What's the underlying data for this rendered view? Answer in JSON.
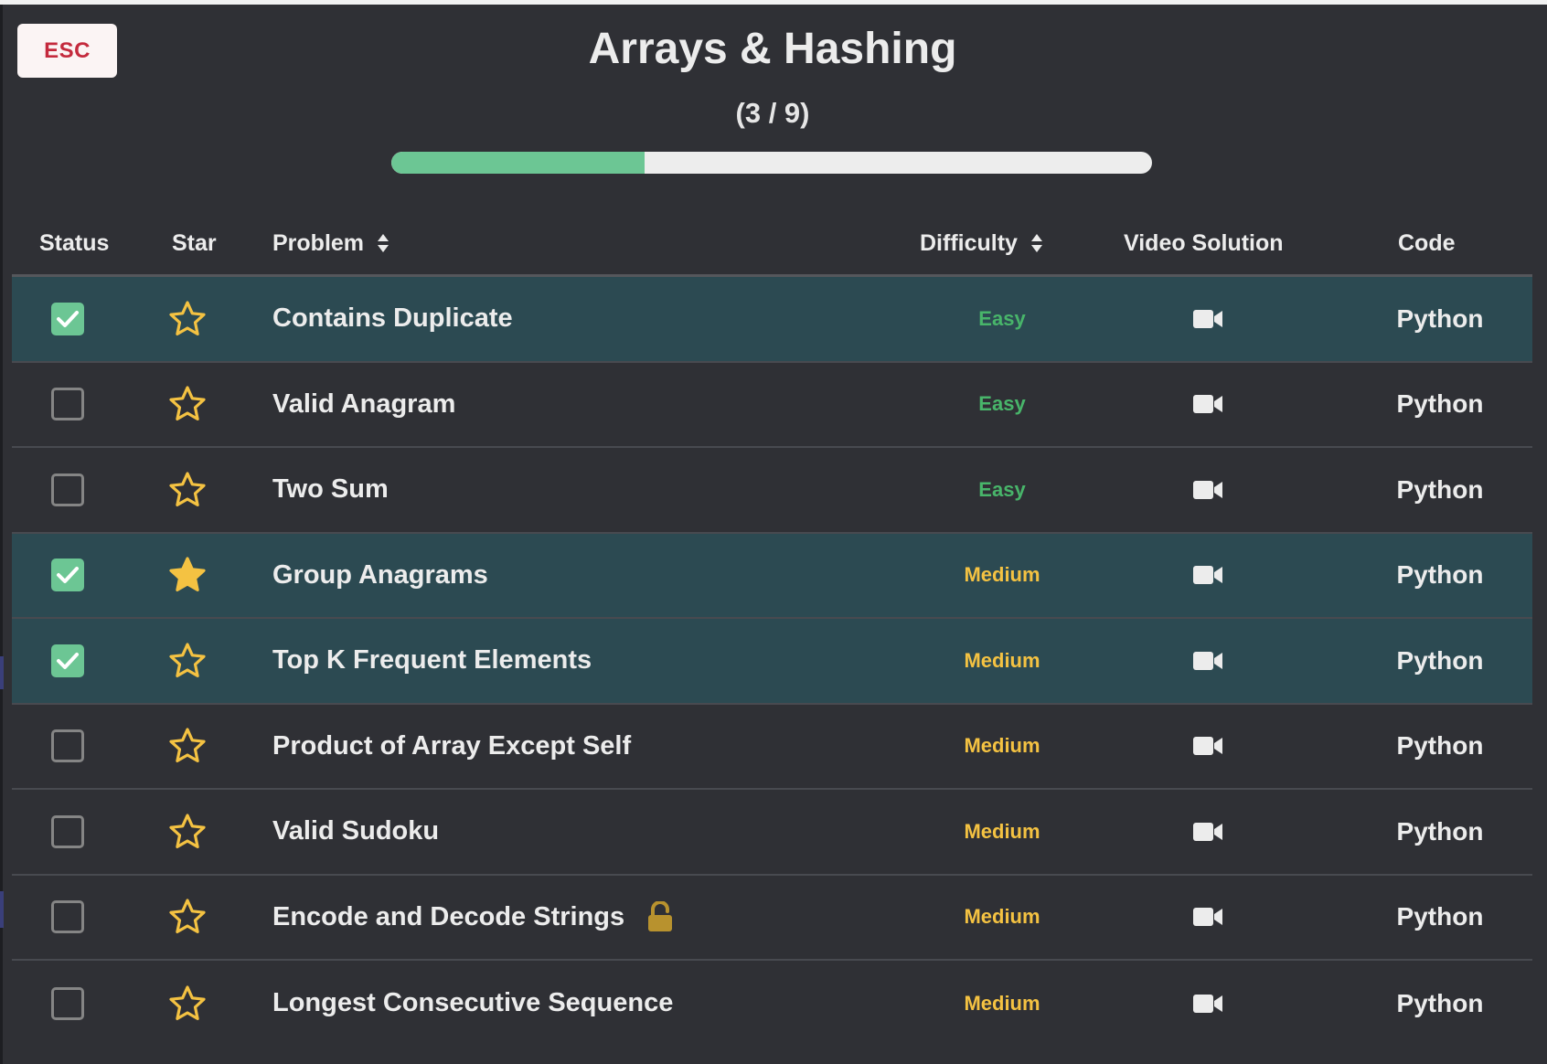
{
  "esc_label": "ESC",
  "title": "Arrays & Hashing",
  "progress": {
    "text": "(3 / 9)",
    "completed": 3,
    "total": 9
  },
  "columns": {
    "status": "Status",
    "star": "Star",
    "problem": "Problem",
    "difficulty": "Difficulty",
    "video": "Video Solution",
    "code": "Code"
  },
  "icons": {
    "checkmark": "check-icon",
    "star_outline": "star-outline-icon",
    "star_filled": "star-filled-icon",
    "video": "video-camera-icon",
    "lock": "unlock-icon",
    "sort": "sort-icon"
  },
  "colors": {
    "background": "#2f3035",
    "completed_row": "#2c4a52",
    "progress_fill": "#6cc694",
    "easy": "#48b56a",
    "medium": "#f4c242",
    "star": "#f4c242",
    "esc_text": "#c42a3d"
  },
  "problems": [
    {
      "name": "Contains Duplicate",
      "difficulty": "Easy",
      "completed": true,
      "starred": false,
      "code": "Python",
      "locked": false
    },
    {
      "name": "Valid Anagram",
      "difficulty": "Easy",
      "completed": false,
      "starred": false,
      "code": "Python",
      "locked": false
    },
    {
      "name": "Two Sum",
      "difficulty": "Easy",
      "completed": false,
      "starred": false,
      "code": "Python",
      "locked": false
    },
    {
      "name": "Group Anagrams",
      "difficulty": "Medium",
      "completed": true,
      "starred": true,
      "code": "Python",
      "locked": false
    },
    {
      "name": "Top K Frequent Elements",
      "difficulty": "Medium",
      "completed": true,
      "starred": false,
      "code": "Python",
      "locked": false
    },
    {
      "name": "Product of Array Except Self",
      "difficulty": "Medium",
      "completed": false,
      "starred": false,
      "code": "Python",
      "locked": false
    },
    {
      "name": "Valid Sudoku",
      "difficulty": "Medium",
      "completed": false,
      "starred": false,
      "code": "Python",
      "locked": false
    },
    {
      "name": "Encode and Decode Strings",
      "difficulty": "Medium",
      "completed": false,
      "starred": false,
      "code": "Python",
      "locked": true
    },
    {
      "name": "Longest Consecutive Sequence",
      "difficulty": "Medium",
      "completed": false,
      "starred": false,
      "code": "Python",
      "locked": false
    }
  ]
}
